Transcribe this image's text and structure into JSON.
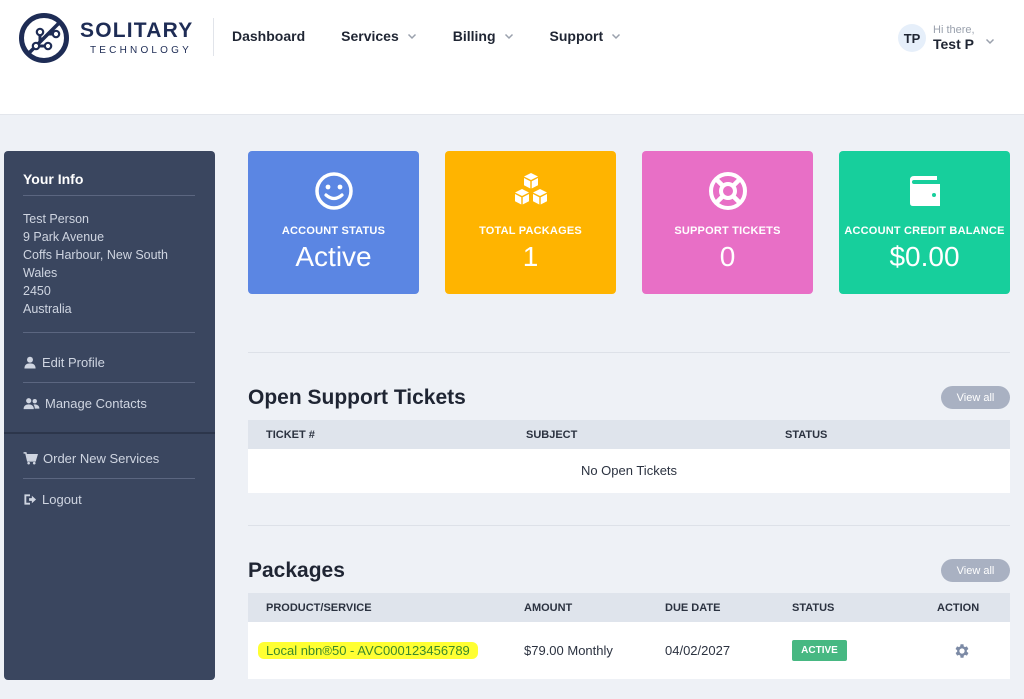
{
  "brand": {
    "name": "SOLITARY",
    "subtitle": "TECHNOLOGY"
  },
  "nav": [
    {
      "label": "Dashboard",
      "has_dropdown": false
    },
    {
      "label": "Services",
      "has_dropdown": true
    },
    {
      "label": "Billing",
      "has_dropdown": true
    },
    {
      "label": "Support",
      "has_dropdown": true
    }
  ],
  "user": {
    "initials": "TP",
    "greeting": "Hi there,",
    "name": "Test P"
  },
  "sidebar": {
    "title": "Your Info",
    "address": [
      "Test Person",
      "9 Park Avenue",
      "Coffs Harbour, New South Wales",
      "2450",
      "Australia"
    ],
    "links": [
      {
        "label": "Edit Profile",
        "icon": "user-icon"
      },
      {
        "label": "Manage Contacts",
        "icon": "users-icon"
      },
      {
        "label": "Order New Services",
        "icon": "cart-icon"
      },
      {
        "label": "Logout",
        "icon": "logout-icon"
      }
    ]
  },
  "stats": [
    {
      "label": "ACCOUNT STATUS",
      "value": "Active",
      "color": "#5b86e3",
      "icon": "smile-icon"
    },
    {
      "label": "TOTAL PACKAGES",
      "value": "1",
      "color": "#ffb400",
      "icon": "boxes-icon"
    },
    {
      "label": "SUPPORT TICKETS",
      "value": "0",
      "color": "#e86fc6",
      "icon": "lifebuoy-icon"
    },
    {
      "label": "ACCOUNT CREDIT BALANCE",
      "value": "$0.00",
      "color": "#17cf9c",
      "icon": "wallet-icon"
    }
  ],
  "tickets": {
    "title": "Open Support Tickets",
    "view_all": "View all",
    "columns": [
      "TICKET #",
      "SUBJECT",
      "STATUS"
    ],
    "empty_message": "No Open Tickets"
  },
  "packages": {
    "title": "Packages",
    "view_all": "View all",
    "columns": [
      "PRODUCT/SERVICE",
      "AMOUNT",
      "DUE DATE",
      "STATUS",
      "ACTION"
    ],
    "rows": [
      {
        "product": "Local nbn®50 - AVC000123456789",
        "amount": "$79.00 Monthly",
        "due_date": "04/02/2027",
        "status": "ACTIVE"
      }
    ]
  }
}
